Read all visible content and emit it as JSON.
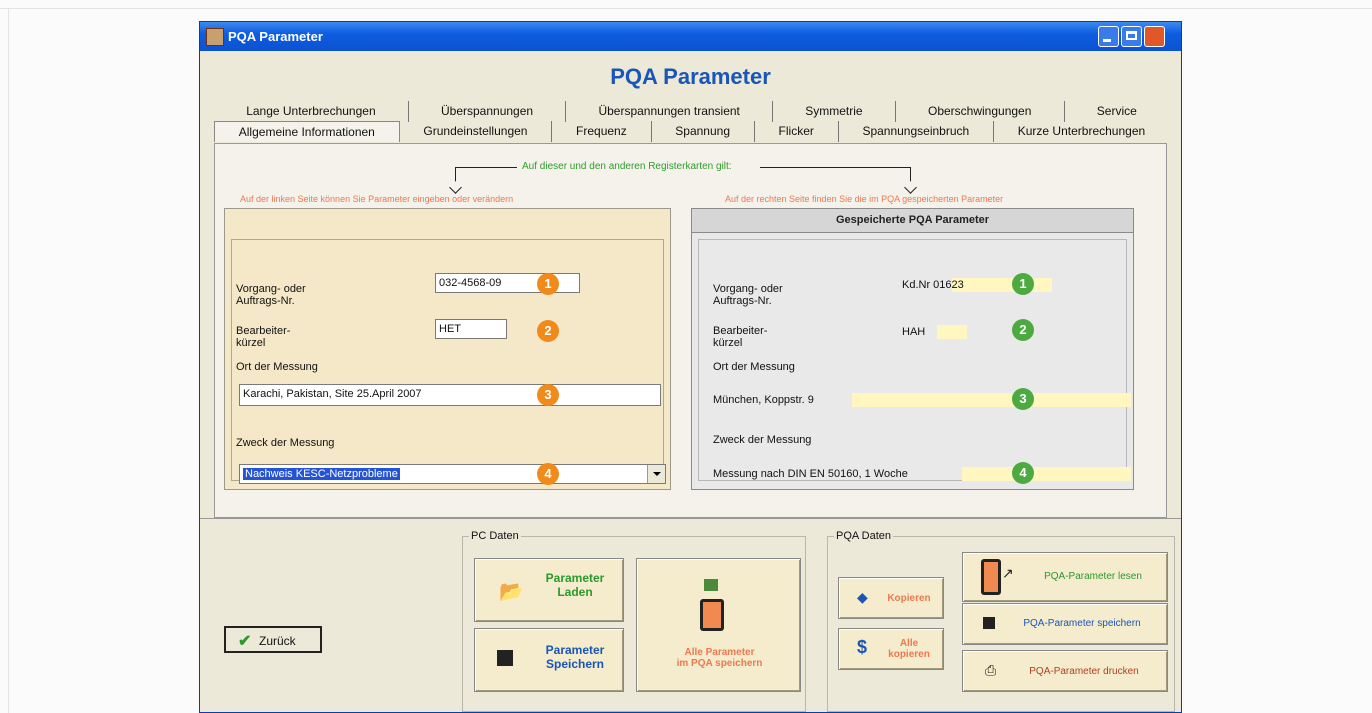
{
  "window": {
    "title": "PQA Parameter",
    "heading": "PQA Parameter"
  },
  "tabs": {
    "row1": [
      "Lange Unterbrechungen",
      "Überspannungen",
      "Überspannungen transient",
      "Symmetrie",
      "Oberschwingungen",
      "Service"
    ],
    "row2": [
      "Allgemeine Informationen",
      "Grundeinstellungen",
      "Frequenz",
      "Spannung",
      "Flicker",
      "Spannungseinbruch",
      "Kurze Unterbrechungen"
    ],
    "active": "Allgemeine Informationen"
  },
  "notes": {
    "top": "Auf dieser und den anderen Registerkarten gilt:",
    "left": "Auf der linken Seite können Sie Parameter eingeben oder verändern",
    "right": "Auf der rechten Seite finden Sie die im PQA gespeicherten Parameter"
  },
  "left_panel": {
    "vorgang_label": "Vorgang- oder\nAuftrags-Nr.",
    "vorgang_value": "032-4568-09",
    "bearbeiter_label": "Bearbeiter-\nkürzel",
    "bearbeiter_value": "HET",
    "ort_label": "Ort der Messung",
    "ort_value": "Karachi, Pakistan, Site 25.April 2007",
    "zweck_label": "Zweck der Messung",
    "zweck_value": "Nachweis KESC-Netzprobleme"
  },
  "right_panel": {
    "header": "Gespeicherte PQA Parameter",
    "vorgang_label": "Vorgang- oder\nAuftrags-Nr.",
    "vorgang_value": "Kd.Nr 01623",
    "bearbeiter_label": "Bearbeiter-\nkürzel",
    "bearbeiter_value": "HAH",
    "ort_label": "Ort der Messung",
    "ort_value": "München, Koppstr. 9",
    "zweck_label": "Zweck der Messung",
    "zweck_value": "Messung nach DIN EN 50160, 1 Woche"
  },
  "badges": {
    "b1": "1",
    "b2": "2",
    "b3": "3",
    "b4": "4"
  },
  "colors": {
    "badge_left": "#f08a1a",
    "badge_right": "#4caa40",
    "heading": "#1a55b8",
    "note_green": "#2e9e2e",
    "note_orange": "#f07850"
  },
  "bottom": {
    "zurueck": "Zurück",
    "pc_group": "PC Daten",
    "pc_laden": "Parameter\nLaden",
    "pc_speichern": "Parameter\nSpeichern",
    "pc_alle": "Alle Parameter\nim PQA speichern",
    "pqa_group": "PQA Daten",
    "pqa_kopieren": "Kopieren",
    "pqa_alle_kopieren": "Alle\nkopieren",
    "pqa_lesen": "PQA-Parameter lesen",
    "pqa_speichern": "PQA-Parameter speichern",
    "pqa_drucken": "PQA-Parameter drucken"
  }
}
